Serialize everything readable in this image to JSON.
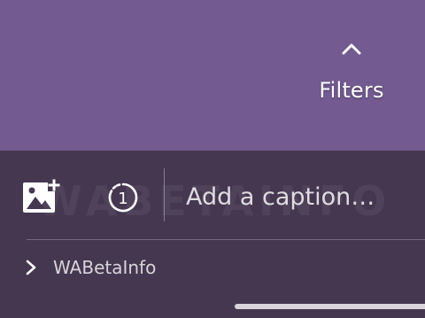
{
  "filters": {
    "label": "Filters",
    "icon": "chevron-up-icon"
  },
  "composer": {
    "add_media_icon": "add-image-icon",
    "view_once_icon": "view-once-icon",
    "view_once_count": "1",
    "caption_placeholder": "Add a caption…",
    "caption_value": ""
  },
  "recipient": {
    "icon": "chevron-right-icon",
    "name": "WABetaInfo"
  },
  "watermark": {
    "text": "WABETAINFO"
  },
  "colors": {
    "top_background": "#735a90",
    "bottom_background": "#453750",
    "text": "#ffffff"
  }
}
